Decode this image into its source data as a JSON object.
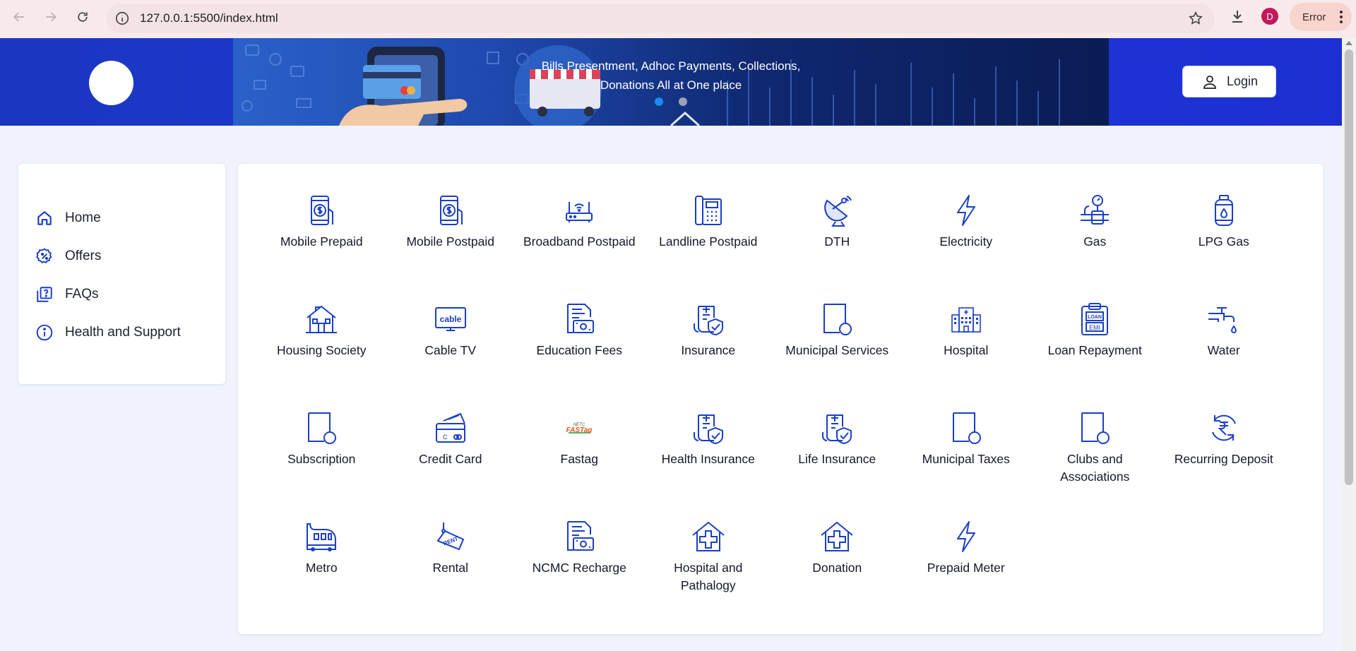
{
  "browser": {
    "url": "127.0.0.1:5500/index.html",
    "profile_initial": "D",
    "error_label": "Error"
  },
  "header": {
    "banner_line1": "Bills Presentment, Adhoc Payments, Collections,",
    "banner_line2": "Donations All at One place",
    "login_label": "Login"
  },
  "sidebar": {
    "items": [
      {
        "label": "Home",
        "icon": "home-icon"
      },
      {
        "label": "Offers",
        "icon": "offers-icon"
      },
      {
        "label": "FAQs",
        "icon": "faq-icon"
      },
      {
        "label": "Health and Support",
        "icon": "info-icon"
      }
    ]
  },
  "categories": [
    {
      "label": "Mobile Prepaid",
      "icon": "mobile-payment-icon"
    },
    {
      "label": "Mobile Postpaid",
      "icon": "mobile-payment-icon"
    },
    {
      "label": "Broadband Postpaid",
      "icon": "router-icon"
    },
    {
      "label": "Landline Postpaid",
      "icon": "landline-icon"
    },
    {
      "label": "DTH",
      "icon": "satellite-dish-icon"
    },
    {
      "label": "Electricity",
      "icon": "lightning-icon"
    },
    {
      "label": "Gas",
      "icon": "gas-pipe-icon"
    },
    {
      "label": "LPG Gas",
      "icon": "gas-cylinder-icon"
    },
    {
      "label": "Housing Society",
      "icon": "house-icon"
    },
    {
      "label": "Cable TV",
      "icon": "cable-tv-icon"
    },
    {
      "label": "Education Fees",
      "icon": "education-fees-icon"
    },
    {
      "label": "Insurance",
      "icon": "insurance-icon"
    },
    {
      "label": "Municipal Services",
      "icon": "document-icon"
    },
    {
      "label": "Hospital",
      "icon": "hospital-building-icon"
    },
    {
      "label": "Loan Repayment",
      "icon": "loan-emi-icon"
    },
    {
      "label": "Water",
      "icon": "water-tap-icon"
    },
    {
      "label": "Subscription",
      "icon": "document-icon"
    },
    {
      "label": "Credit Card",
      "icon": "credit-card-icon"
    },
    {
      "label": "Fastag",
      "icon": "fastag-logo-icon",
      "logo_text": "FASTag"
    },
    {
      "label": "Health Insurance",
      "icon": "insurance-icon"
    },
    {
      "label": "Life Insurance",
      "icon": "insurance-icon"
    },
    {
      "label": "Municipal Taxes",
      "icon": "document-icon"
    },
    {
      "label": "Clubs and Associations",
      "icon": "document-icon"
    },
    {
      "label": "Recurring Deposit",
      "icon": "rupee-cycle-icon"
    },
    {
      "label": "Metro",
      "icon": "metro-train-icon"
    },
    {
      "label": "Rental",
      "icon": "rent-sign-icon",
      "sign_text": "RENT"
    },
    {
      "label": "NCMC Recharge",
      "icon": "education-fees-icon"
    },
    {
      "label": "Hospital and Pathalogy",
      "icon": "medical-house-icon"
    },
    {
      "label": "Donation",
      "icon": "medical-house-icon"
    },
    {
      "label": "Prepaid Meter",
      "icon": "lightning-icon"
    }
  ],
  "colors": {
    "header_blue": "#1f3ad8",
    "icon_blue": "#1a3fc4",
    "page_bg": "#f0f3fb"
  }
}
